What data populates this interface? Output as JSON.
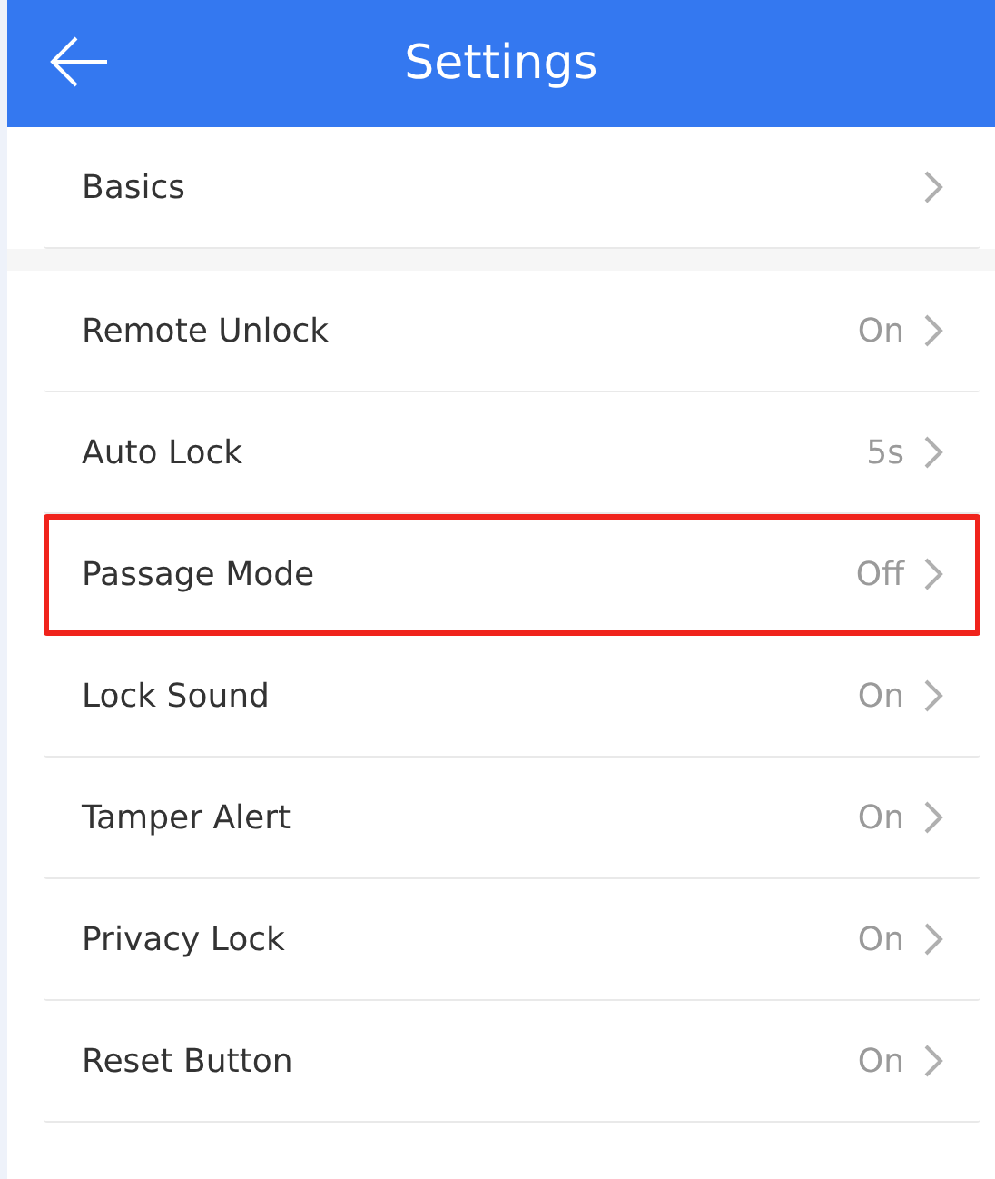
{
  "header": {
    "title": "Settings"
  },
  "basics": {
    "label": "Basics"
  },
  "items": [
    {
      "label": "Remote Unlock",
      "value": "On",
      "highlighted": false
    },
    {
      "label": "Auto Lock",
      "value": "5s",
      "highlighted": false
    },
    {
      "label": "Passage Mode",
      "value": "Off",
      "highlighted": true
    },
    {
      "label": "Lock Sound",
      "value": "On",
      "highlighted": false
    },
    {
      "label": "Tamper Alert",
      "value": "On",
      "highlighted": false
    },
    {
      "label": "Privacy Lock",
      "value": "On",
      "highlighted": false
    },
    {
      "label": "Reset Button",
      "value": "On",
      "highlighted": false
    }
  ]
}
